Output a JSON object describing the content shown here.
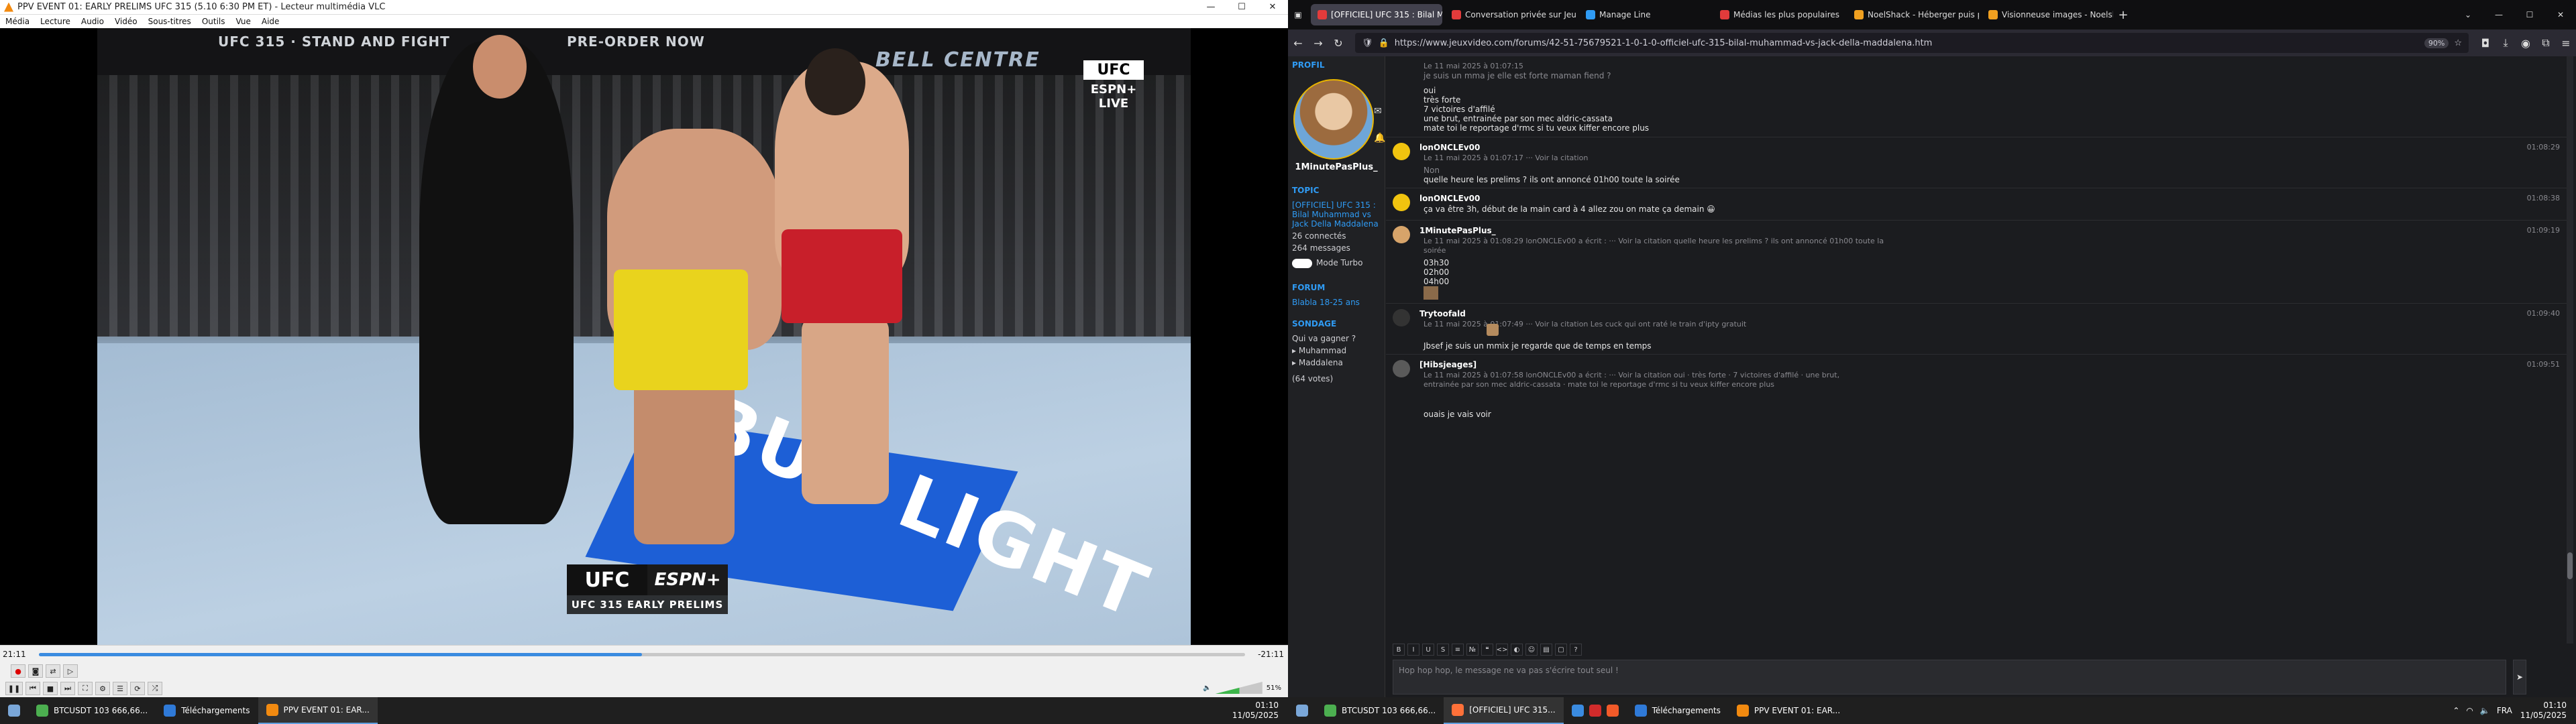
{
  "vlc": {
    "title": "PPV EVENT 01: EARLY PRELIMS UFC 315 (5.10 6:30 PM ET) - Lecteur multimédia VLC",
    "menu": [
      "Média",
      "Lecture",
      "Audio",
      "Vidéo",
      "Sous-titres",
      "Outils",
      "Vue",
      "Aide"
    ],
    "video": {
      "banner_left": "UFC 315 · STAND AND FIGHT",
      "banner_mid": "PRE-ORDER NOW",
      "venue": "BELL CENTRE",
      "badge_ufc": "UFC",
      "badge_espn": "ESPN+",
      "badge_live": "LIVE",
      "lower_ufc": "UFC",
      "lower_espn": "ESPN+",
      "lower_title": "UFC 315 EARLY PRELIMS",
      "mat_text": "BUD LIGHT"
    },
    "time_elapsed": "21:11",
    "time_remaining": "-21:11",
    "progress": 0.5,
    "volume": "51%",
    "taskbar": {
      "items": [
        "BTCUSDT 103 666,66...",
        "Téléchargements",
        "PPV EVENT 01: EAR..."
      ],
      "time": "01:10",
      "date": "11/05/2025"
    }
  },
  "firefox": {
    "tabs": [
      {
        "label": "[OFFICIEL] UFC 315 : Bilal Muh",
        "color": "#e23b3b"
      },
      {
        "label": "Conversation privée sur Jeuxvi",
        "color": "#e23b3b"
      },
      {
        "label": "Manage Line",
        "color": "#2f9bf4"
      },
      {
        "label": "Médias les plus populaires",
        "color": "#e23b3b"
      },
      {
        "label": "NoelShack - Héberger puis part",
        "color": "#f0a020"
      },
      {
        "label": "Visionneuse images - Noelshac",
        "color": "#f0a020"
      }
    ],
    "url": "https://www.jeuxvideo.com/forums/42-51-75679521-1-0-1-0-officiel-ufc-315-bilal-muhammad-vs-jack-della-maddalena.htm",
    "zoom": "90%",
    "sidebar": {
      "profil_heading": "PROFIL",
      "username": "1MinutePasPlus_",
      "topic_heading": "TOPIC",
      "topic_title": "[OFFICIEL] UFC 315 : Bilal Muhammad vs Jack Della Maddalena",
      "connected": "26 connectés",
      "messages": "264 messages",
      "turbo": "Mode Turbo",
      "forum_heading": "FORUM",
      "forum_name": "Blabla 18-25 ans",
      "poll_heading": "SONDAGE",
      "poll_question": "Qui va gagner ?",
      "poll_opt1": "Muhammad",
      "poll_opt2": "Maddalena",
      "poll_votes": "(64 votes)"
    },
    "posts": [
      {
        "author": "",
        "time": "",
        "quote": "Le 11 mai 2025 à 01:07:15",
        "body": [
          "je suis un mma je elle est forte maman fiend ?",
          "oui",
          "très forte",
          "7 victoires d'affilé",
          "une brut, entrainée par son mec aldric-cassata",
          "mate toi le reportage d'rmc si tu veux kiffer encore plus"
        ]
      },
      {
        "author": "lonONCLEv00",
        "time": "01:08:29",
        "quote": "Le 11 mai 2025 à 01:07:17   ··· Voir la citation",
        "body": [
          "Non",
          "quelle heure les prelims ? ils ont annoncé 01h00 toute la soirée"
        ]
      },
      {
        "author": "lonONCLEv00",
        "time": "01:08:38",
        "quote": "",
        "body": [
          "ça va être 3h, début de la main card à 4 allez zou on mate ça demain 😀"
        ]
      },
      {
        "author": "1MinutePasPlus_",
        "time": "01:09:19",
        "quote": "Le 11 mai 2025 à 01:08:29 lonONCLEv00 a écrit :   ··· Voir la citation   quelle heure les prelims ? ils ont annoncé 01h00 toute la soirée",
        "body": [
          "03h30",
          "02h00",
          "04h00"
        ]
      },
      {
        "author": "Trytoofald",
        "time": "01:09:40",
        "quote": "Le 11 mai 2025 à 01:07:49   ··· Voir la citation   Les cuck qui ont raté le train d'ipty gratuit",
        "body": [
          "Jbsef je suis un mmix je regarde que de temps en temps"
        ]
      },
      {
        "author": "[Hibsjeages]",
        "time": "01:09:51",
        "quote": "Le 11 mai 2025 à 01:07:58 lonONCLEv00 a écrit :   ··· Voir la citation   oui · très forte · 7 victoires d'affilé · une brut, entrainée par son mec aldric-cassata · mate toi le reportage d'rmc si tu veux kiffer encore plus",
        "body": [
          "ouais je vais voir"
        ]
      }
    ],
    "editor_placeholder": "Hop hop hop, le message ne va pas s'écrire tout seul !",
    "taskbar": {
      "items": [
        "BTCUSDT 103 666,66...",
        "[OFFICIEL] UFC 315...",
        "Téléchargements",
        "PPV EVENT 01: EAR..."
      ],
      "time": "01:10",
      "date": "11/05/2025",
      "lang": "FRA"
    }
  }
}
